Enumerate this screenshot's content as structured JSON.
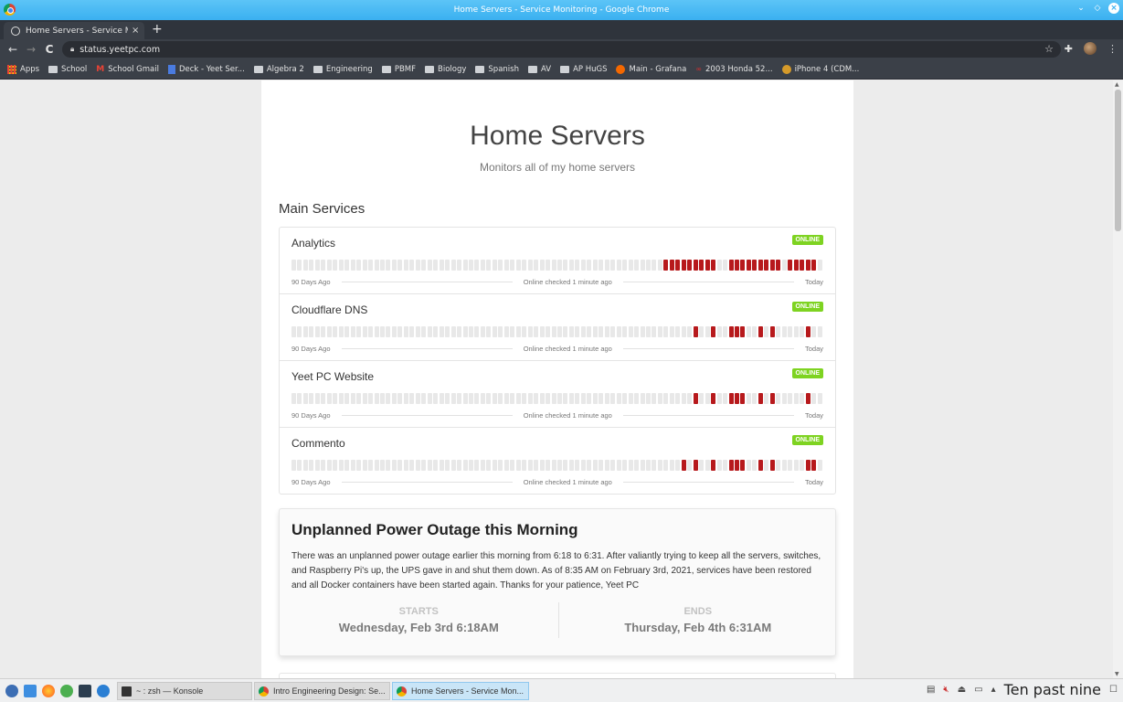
{
  "window": {
    "title": "Home Servers - Service Monitoring - Google Chrome",
    "controls": [
      "minimize",
      "maximize",
      "close"
    ]
  },
  "browser": {
    "tab": {
      "title": "Home Servers - Service Monitoring",
      "close": "×"
    },
    "new_tab": "+",
    "nav": {
      "back": "←",
      "forward": "→",
      "reload": "C"
    },
    "url": "status.yeetpc.com",
    "bookmarks": [
      {
        "label": "Apps",
        "icon": "apps-grid-icon"
      },
      {
        "label": "School",
        "icon": "folder-icon"
      },
      {
        "label": "School Gmail",
        "icon": "gmail-icon"
      },
      {
        "label": "Deck - Yeet Ser...",
        "icon": "deck-icon"
      },
      {
        "label": "Algebra 2",
        "icon": "folder-icon"
      },
      {
        "label": "Engineering",
        "icon": "folder-icon"
      },
      {
        "label": "PBMF",
        "icon": "folder-icon"
      },
      {
        "label": "Biology",
        "icon": "folder-icon"
      },
      {
        "label": "Spanish",
        "icon": "folder-icon"
      },
      {
        "label": "AV",
        "icon": "folder-icon"
      },
      {
        "label": "AP HuGS",
        "icon": "folder-icon"
      },
      {
        "label": "Main - Grafana",
        "icon": "grafana-icon"
      },
      {
        "label": "2003 Honda 52...",
        "icon": "honda-icon"
      },
      {
        "label": "iPhone 4 (CDM...",
        "icon": "iphone-icon"
      }
    ]
  },
  "page": {
    "title": "Home Servers",
    "subtitle": "Monitors all of my home servers",
    "section_title": "Main Services",
    "bar_count": 90,
    "colors": {
      "up": "#e8e8e8",
      "down": "#b7191c",
      "online_badge": "#7ed321"
    },
    "services": [
      {
        "name": "Analytics",
        "status": "ONLINE",
        "down_days": [
          63,
          64,
          65,
          66,
          67,
          68,
          69,
          70,
          71,
          74,
          75,
          76,
          77,
          78,
          79,
          80,
          81,
          82,
          84,
          85,
          86,
          87,
          88
        ],
        "legend_left": "90 Days Ago",
        "legend_center": "Online checked 1 minute ago",
        "legend_right": "Today"
      },
      {
        "name": "Cloudflare DNS",
        "status": "ONLINE",
        "down_days": [
          68,
          71,
          74,
          75,
          76,
          79,
          81,
          87
        ],
        "legend_left": "90 Days Ago",
        "legend_center": "Online checked 1 minute ago",
        "legend_right": "Today"
      },
      {
        "name": "Yeet PC Website",
        "status": "ONLINE",
        "down_days": [
          68,
          71,
          74,
          75,
          76,
          79,
          81,
          87
        ],
        "legend_left": "90 Days Ago",
        "legend_center": "Online checked 1 minute ago",
        "legend_right": "Today"
      },
      {
        "name": "Commento",
        "status": "ONLINE",
        "down_days": [
          66,
          68,
          71,
          74,
          75,
          76,
          79,
          81,
          87,
          88
        ],
        "legend_left": "90 Days Ago",
        "legend_center": "Online checked 1 minute ago",
        "legend_right": "Today"
      }
    ],
    "incident": {
      "title": "Unplanned Power Outage this Morning",
      "body": "There was an unplanned power outage earlier this morning from 6:18 to 6:31. After valiantly trying to keep all the servers, switches, and Raspberry Pi's up, the UPS gave in and shut them down. As of 8:35 AM on February 3rd, 2021, services have been restored and all Docker containers have been started again. Thanks for your patience, Yeet PC",
      "starts_label": "STARTS",
      "starts_value": "Wednesday, Feb 3rd 6:18AM",
      "ends_label": "ENDS",
      "ends_value": "Thursday, Feb 4th 6:31AM"
    }
  },
  "taskbar": {
    "launchers": [
      "fedora-icon",
      "files-icon",
      "firefox-icon",
      "app-icon",
      "vscode-icon",
      "thunderbird-icon"
    ],
    "tasks": [
      {
        "label": "~ : zsh — Konsole",
        "icon": "konsole-icon",
        "active": false
      },
      {
        "label": "Intro Engineering Design: Se...",
        "icon": "chrome-icon",
        "active": false
      },
      {
        "label": "Home Servers - Service Mon...",
        "icon": "chrome-icon",
        "active": true
      }
    ],
    "clock": "Ten past nine"
  }
}
